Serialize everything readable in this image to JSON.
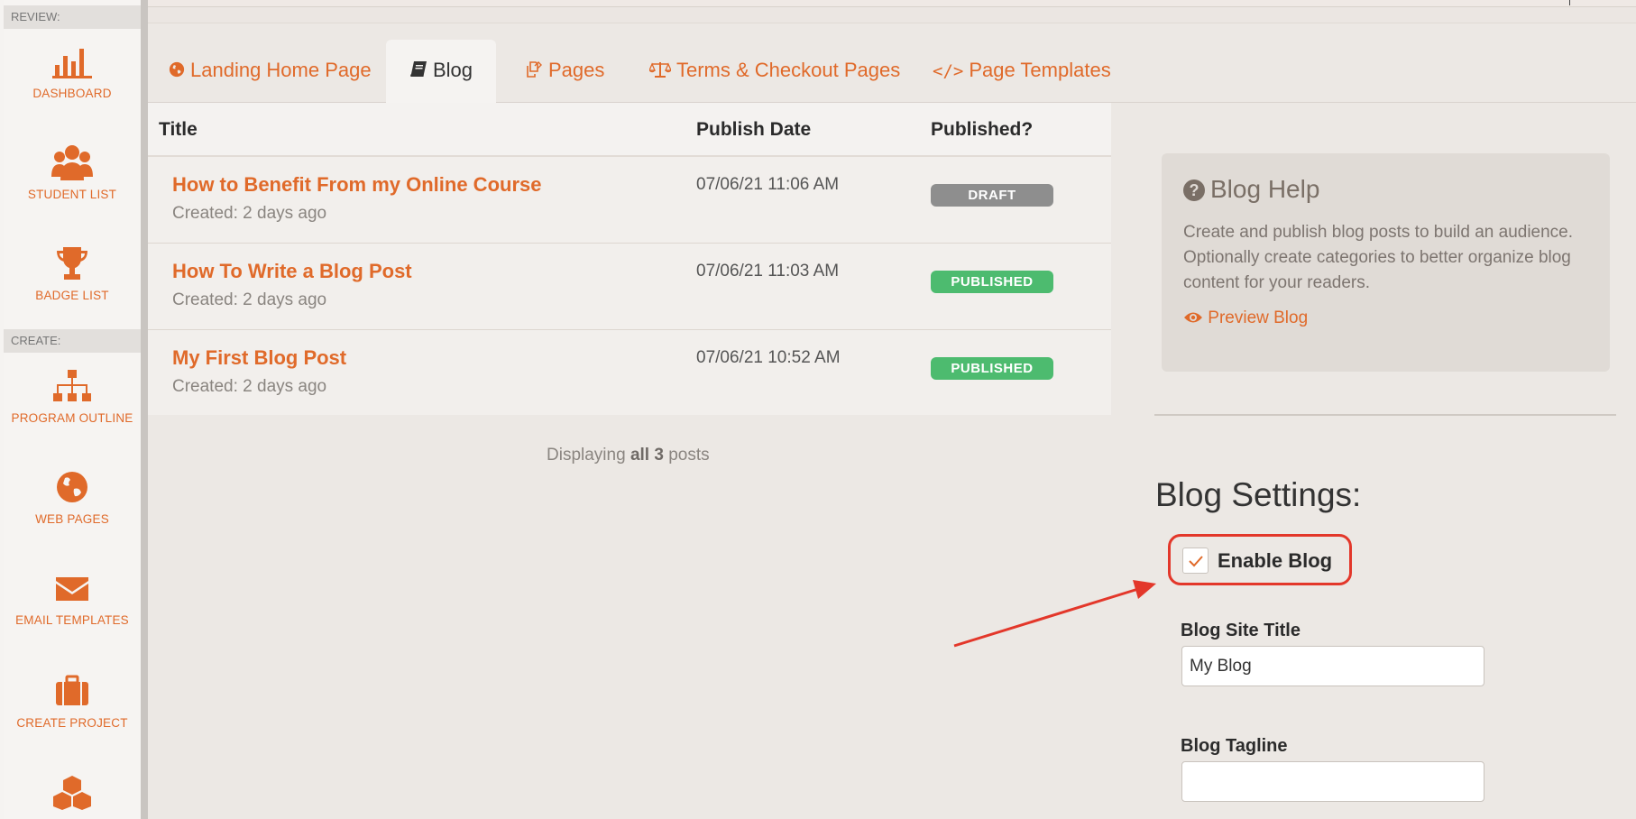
{
  "sidebar": {
    "sections": [
      {
        "label": "REVIEW:"
      },
      {
        "label": "CREATE:"
      }
    ],
    "items": [
      {
        "label": "DASHBOARD",
        "icon": "bar-chart-icon"
      },
      {
        "label": "STUDENT LIST",
        "icon": "users-icon"
      },
      {
        "label": "BADGE LIST",
        "icon": "trophy-icon"
      },
      {
        "label": "PROGRAM OUTLINE",
        "icon": "sitemap-icon"
      },
      {
        "label": "WEB PAGES",
        "icon": "globe-icon"
      },
      {
        "label": "EMAIL TEMPLATES",
        "icon": "envelope-icon"
      },
      {
        "label": "CREATE PROJECT",
        "icon": "briefcase-icon"
      },
      {
        "label": "",
        "icon": "cubes-icon"
      }
    ]
  },
  "tabs": [
    {
      "label": "Landing Home Page",
      "icon": "globe-icon",
      "active": false
    },
    {
      "label": "Blog",
      "icon": "book-icon",
      "active": true
    },
    {
      "label": "Pages",
      "icon": "copy-icon",
      "active": false
    },
    {
      "label": "Terms & Checkout Pages",
      "icon": "balance-scale-icon",
      "active": false
    },
    {
      "label": "Page Templates",
      "icon": "code-icon",
      "active": false
    }
  ],
  "table": {
    "headers": {
      "title": "Title",
      "date": "Publish Date",
      "published": "Published?"
    },
    "rows": [
      {
        "title": "How to Benefit From my Online Course",
        "created": "Created: 2 days ago",
        "date": "07/06/21 11:06 AM",
        "status": "DRAFT"
      },
      {
        "title": "How To Write a Blog Post",
        "created": "Created: 2 days ago",
        "date": "07/06/21 11:03 AM",
        "status": "PUBLISHED"
      },
      {
        "title": "My First Blog Post",
        "created": "Created: 2 days ago",
        "date": "07/06/21 10:52 AM",
        "status": "PUBLISHED"
      }
    ],
    "footer": {
      "prefix": "Displaying ",
      "bold": "all 3",
      "suffix": " posts"
    }
  },
  "help": {
    "title": "Blog Help",
    "text": "Create and publish blog posts to build an audience. Optionally create categories to better organize blog content for your readers.",
    "preview_link": "Preview Blog"
  },
  "settings": {
    "heading": "Blog Settings:",
    "enable_label": "Enable Blog",
    "enable_checked": true,
    "site_title_label": "Blog Site Title",
    "site_title_value": "My Blog",
    "tagline_label": "Blog Tagline",
    "tagline_value": ""
  },
  "colors": {
    "accent": "#e06a2a",
    "draft": "#8e8e8e",
    "published": "#4dbb6f",
    "annotation": "#e3372a"
  }
}
